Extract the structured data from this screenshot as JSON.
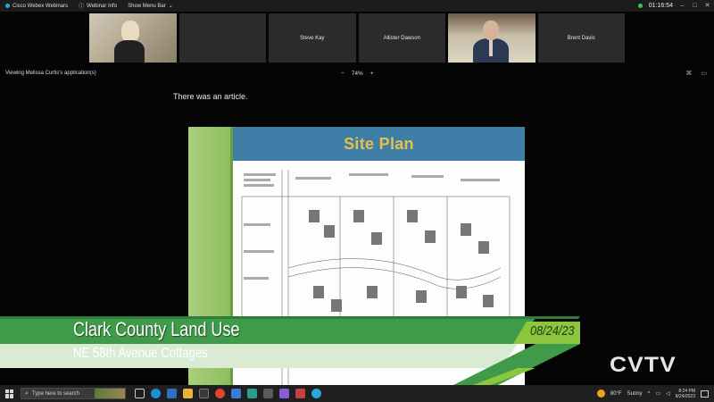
{
  "topbar": {
    "app_name": "Cisco Webex Webinars",
    "webinar_info": "Webinar Info",
    "show_menu_bar": "Show Menu Bar",
    "timer": "01:16:54"
  },
  "participants": [
    {
      "name": "",
      "video": true
    },
    {
      "name": "",
      "video": false
    },
    {
      "name": "Steve Kay",
      "video": false
    },
    {
      "name": "Allister Dawson",
      "video": false
    },
    {
      "name": "",
      "video": true
    },
    {
      "name": "Brent Davis",
      "video": false
    }
  ],
  "viewbar": {
    "label": "Viewing Melissa Curtis's application(s)",
    "zoom_minus": "−",
    "zoom_level": "74%",
    "zoom_plus": "+"
  },
  "content": {
    "caption": "There was an article.",
    "slide_title": "Site Plan"
  },
  "lower_third": {
    "title": "Clark County Land Use",
    "subtitle": "NE 58th Avenue Cottages",
    "date": "08/24/23"
  },
  "logo": "CVTV",
  "taskbar": {
    "search_placeholder": "Type here to search",
    "weather_temp": "80°F",
    "weather_desc": "Sunny",
    "time": "8:24 PM",
    "date": "8/24/2023"
  },
  "colors": {
    "slide_title_bar": "#3f7ea7",
    "slide_title_text": "#e3c14a",
    "slide_side_green": "#9ac66a",
    "lower_third_green": "#3f9a4a",
    "date_band": "#8cc63f"
  }
}
